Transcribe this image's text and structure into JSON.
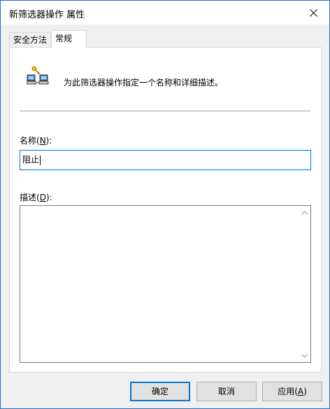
{
  "window": {
    "title": "新筛选器操作 属性",
    "close_icon": "close-icon"
  },
  "tabs": [
    {
      "label": "安全方法",
      "active": false
    },
    {
      "label": "常规",
      "active": true
    }
  ],
  "general": {
    "icon": "filter-action-icon",
    "description": "为此筛选器操作指定一个名称和详细描述。",
    "name_label_prefix": "名称(",
    "name_label_key": "N",
    "name_label_suffix": "):",
    "name_value": "阻止",
    "desc_label_prefix": "描述(",
    "desc_label_key": "D",
    "desc_label_suffix": "):",
    "desc_value": ""
  },
  "buttons": {
    "ok": "确定",
    "cancel": "取消",
    "apply_prefix": "应用(",
    "apply_key": "A",
    "apply_suffix": ")"
  },
  "colors": {
    "accent": "#0078d7",
    "window_bg": "#f0f0f0",
    "panel_bg": "#ffffff"
  }
}
